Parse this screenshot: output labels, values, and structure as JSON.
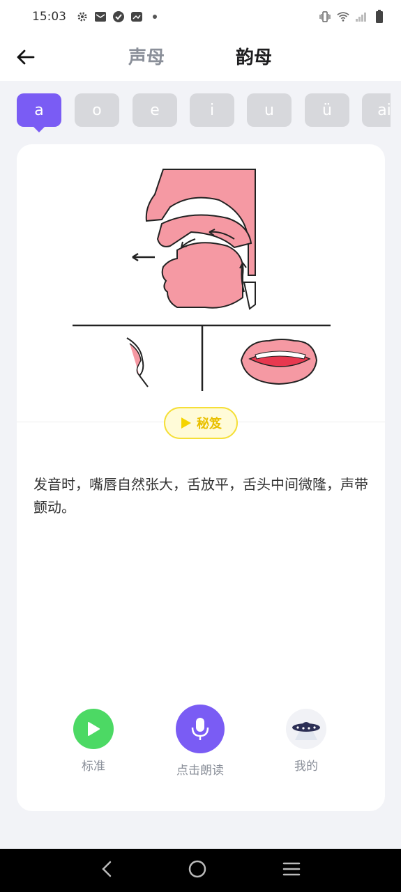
{
  "status_bar": {
    "time": "15:03",
    "icons": [
      "settings-icon",
      "mail-icon",
      "check-icon",
      "gallery-icon",
      "dot-icon",
      "vibrate-icon",
      "wifi-icon",
      "signal-icon",
      "battery-icon"
    ]
  },
  "header": {
    "tab_shengmu": "声母",
    "tab_yunmu": "韵母"
  },
  "chips": [
    "a",
    "o",
    "e",
    "i",
    "u",
    "ü",
    "ai"
  ],
  "card": {
    "tips_label": "秘笈",
    "description": "发音时，嘴唇自然张大，舌放平，舌头中间微隆，声带颤动。"
  },
  "actions": {
    "standard_label": "标准",
    "read_label": "点击朗读",
    "mine_label": "我的"
  },
  "colors": {
    "accent": "#7a5cf4",
    "green": "#4cd964",
    "pink": "#f599a3",
    "yellow": "#f5df38"
  }
}
